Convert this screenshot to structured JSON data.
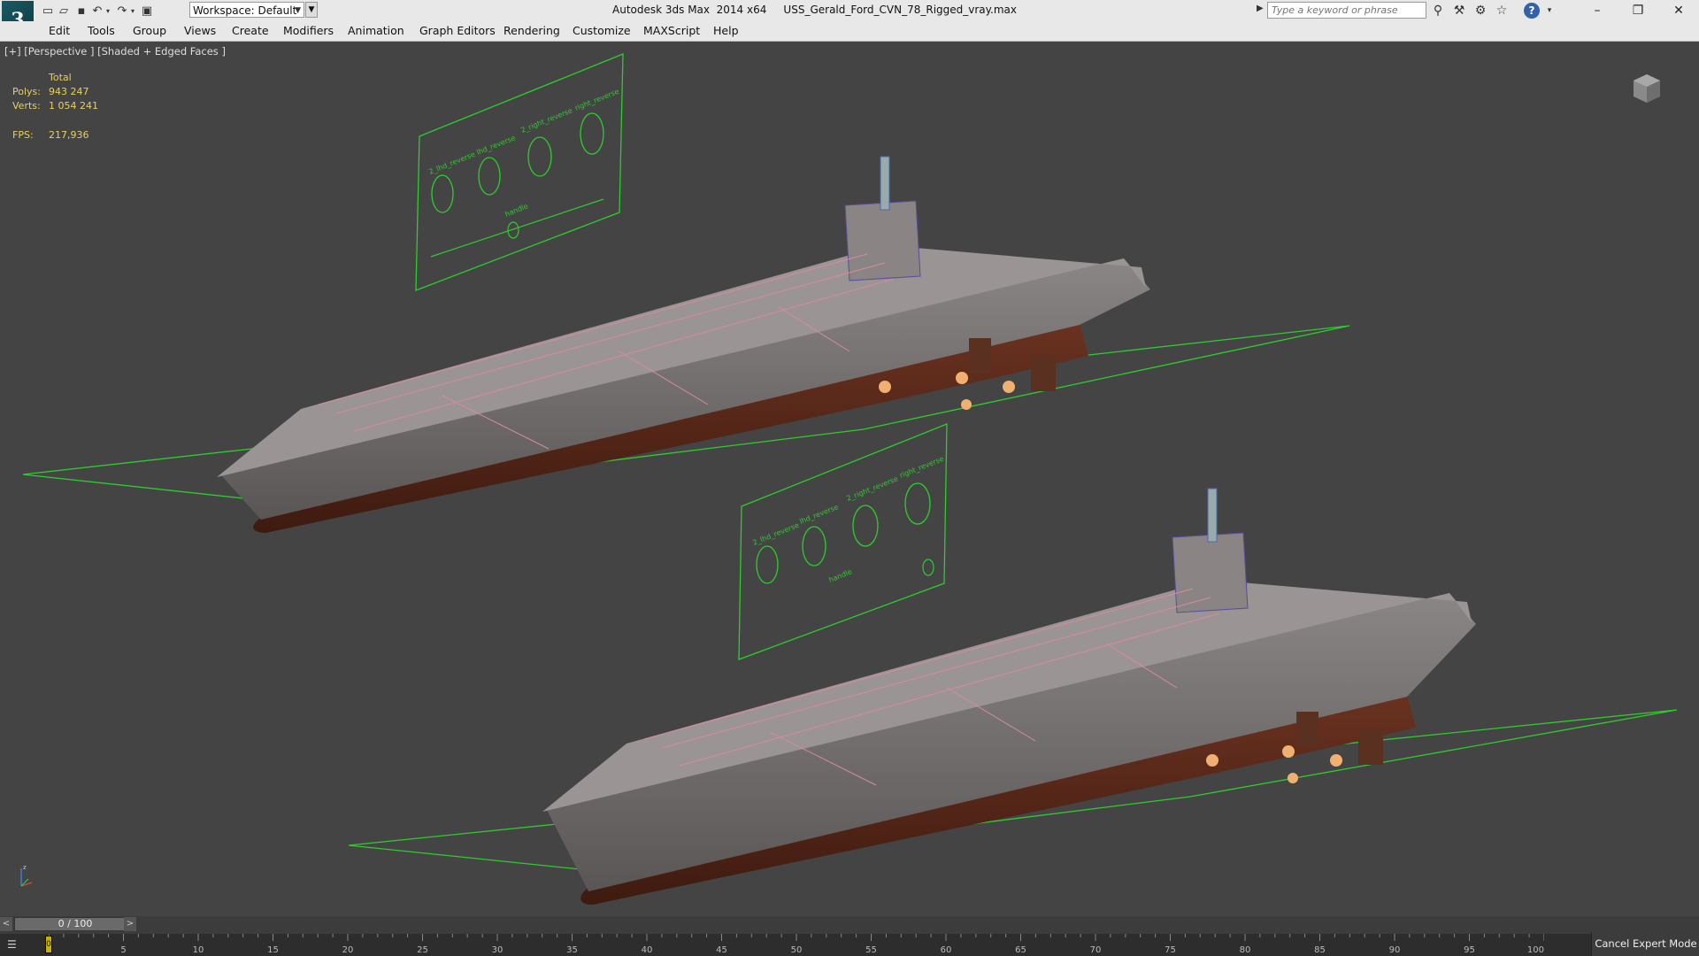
{
  "app": {
    "logo_glyph": "3",
    "title": "Autodesk 3ds Max  2014 x64     USS_Gerald_Ford_CVN_78_Rigged_vray.max"
  },
  "titlebar": {
    "workspace_label": "Workspace: Default",
    "search_placeholder": "Type a keyword or phrase",
    "help_glyph": "?",
    "minimize_glyph": "–",
    "restore_glyph": "❐",
    "close_glyph": "✕"
  },
  "menu": {
    "items": [
      "Edit",
      "Tools",
      "Group",
      "Views",
      "Create",
      "Modifiers",
      "Animation",
      "Graph Editors",
      "Rendering",
      "Customize",
      "MAXScript",
      "Help"
    ]
  },
  "viewport": {
    "label": "[+] [Perspective ] [Shaded + Edged Faces ]",
    "stats": {
      "total_label": "Total",
      "polys_label": "Polys:",
      "polys_value": "943 247",
      "verts_label": "Verts:",
      "verts_value": "1 054 241",
      "fps_label": "FPS:",
      "fps_value": "217,936"
    },
    "rig_panel": {
      "labels": [
        "2_lhd_reverse",
        "lhd_reverse",
        "2_right_reverse",
        "right_reverse"
      ],
      "bottom_label": "handle"
    },
    "axis_z": "z"
  },
  "timeline": {
    "counter": "0 / 100",
    "left_arrow": "<",
    "right_arrow": ">",
    "current_frame": "0",
    "ticks": [
      "0",
      "5",
      "10",
      "15",
      "20",
      "25",
      "30",
      "35",
      "40",
      "45",
      "50",
      "55",
      "60",
      "65",
      "70",
      "75",
      "80",
      "85",
      "90",
      "95",
      "100"
    ]
  },
  "status": {
    "cancel_expert": "Cancel Expert Mode"
  },
  "colors": {
    "viewport_bg": "#444444",
    "rig_green": "#2ecc2e",
    "stats_yellow": "#e8d060",
    "hull_red": "#5a2a18",
    "deck_gray": "#7a7878"
  }
}
